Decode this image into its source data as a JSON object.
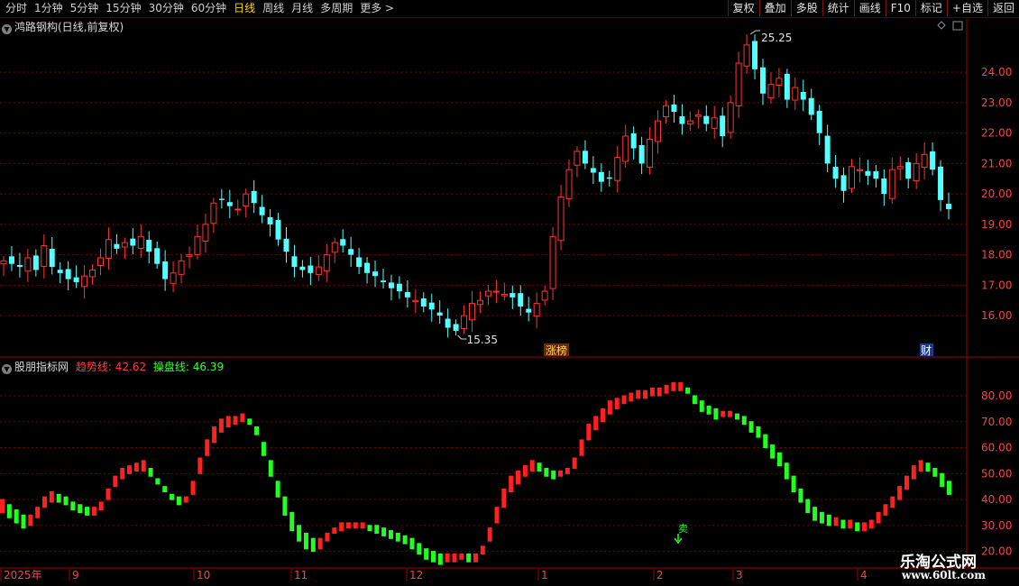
{
  "toolbar": {
    "periods": [
      "分时",
      "1分钟",
      "5分钟",
      "15分钟",
      "30分钟",
      "60分钟",
      "日线",
      "周线",
      "月线",
      "多周期",
      "更多 >"
    ],
    "active_period": "日线",
    "actions": [
      "复权",
      "叠加",
      "多股",
      "统计",
      "画线",
      "F10",
      "标记",
      "+自选",
      "返回"
    ]
  },
  "main_chart": {
    "title": "鸿路钢构(日线,前复权)",
    "y_ticks": [
      "16.00",
      "17.00",
      "18.00",
      "19.00",
      "20.00",
      "21.00",
      "22.00",
      "23.00",
      "24.00"
    ],
    "high_label": "25.25",
    "low_label": "15.35",
    "badge_limit_up": "涨榜",
    "badge_finance": "财"
  },
  "indicator": {
    "name": "股朋指标网",
    "trend_label": "趋势线:",
    "trend_value": "42.62",
    "operate_label": "操盘线:",
    "operate_value": "46.39",
    "y_ticks": [
      "20.00",
      "30.00",
      "40.00",
      "50.00",
      "60.00",
      "70.00",
      "80.00"
    ],
    "sell_marker": "卖"
  },
  "time_axis": [
    "2025年",
    "9",
    "10",
    "11",
    "12",
    "1",
    "2",
    "3",
    "4"
  ],
  "watermark": {
    "name": "乐淘公式网",
    "url": "www.60lt.com"
  },
  "colors": {
    "up": "#ff3333",
    "down": "#54ffff",
    "ind_up": "#ff2020",
    "ind_down": "#22ff22",
    "grid": "#7a0000",
    "active": "#ffd400"
  },
  "chart_data": [
    {
      "type": "candlestick",
      "title": "鸿路钢构(日线,前复权)",
      "ylim": [
        15.0,
        25.5
      ],
      "high": 25.25,
      "low": 15.35,
      "close_series": [
        17.8,
        17.7,
        17.6,
        17.9,
        17.5,
        18.3,
        17.6,
        17.4,
        17.2,
        17.1,
        17.3,
        17.5,
        17.9,
        18.5,
        18.2,
        18.4,
        18.3,
        18.6,
        18.1,
        17.7,
        17.2,
        17.4,
        17.8,
        18.0,
        18.6,
        19.0,
        19.7,
        19.8,
        19.6,
        19.5,
        20.0,
        19.7,
        19.3,
        19.0,
        18.5,
        18.1,
        17.6,
        17.5,
        17.4,
        17.6,
        18.0,
        18.4,
        18.3,
        18.0,
        17.6,
        17.4,
        17.3,
        17.1,
        16.9,
        16.8,
        16.6,
        16.5,
        16.3,
        16.2,
        16.0,
        15.6,
        15.5,
        16.0,
        16.4,
        16.5,
        16.8,
        16.8,
        16.7,
        16.6,
        16.3,
        16.1,
        16.4,
        16.8,
        18.6,
        19.9,
        20.8,
        21.4,
        21.0,
        20.7,
        20.4,
        20.5,
        21.2,
        21.9,
        21.5,
        21.0,
        21.8,
        22.4,
        22.9,
        22.7,
        22.3,
        22.4,
        22.6,
        22.3,
        22.5,
        21.9,
        23.0,
        24.3,
        24.9,
        24.1,
        23.3,
        23.6,
        23.8,
        23.1,
        23.5,
        23.1,
        22.6,
        22.0,
        21.0,
        20.5,
        20.1,
        20.9,
        20.8,
        20.6,
        20.5,
        20.0,
        20.8,
        20.9,
        20.5,
        21.0,
        21.3,
        20.8,
        19.8,
        19.5
      ]
    },
    {
      "type": "area",
      "title": "股朋指标网",
      "ylim": [
        15,
        88
      ],
      "series": [
        {
          "name": "趋势线",
          "values": [
            39,
            37,
            35,
            33,
            33,
            36,
            40,
            42,
            41,
            40,
            38,
            37,
            36,
            36,
            38,
            43,
            48,
            51,
            52,
            53,
            54,
            51,
            47,
            44,
            41,
            39,
            40,
            46,
            55,
            62,
            67,
            70,
            71,
            71,
            72,
            70,
            66,
            58,
            50,
            42,
            35,
            29,
            25,
            22,
            21,
            22,
            25,
            28,
            30,
            30,
            30,
            30,
            29,
            28,
            27,
            26,
            25,
            24,
            22,
            20,
            18,
            17,
            16,
            17,
            17,
            18,
            17,
            17,
            21,
            28,
            36,
            43,
            48,
            50,
            52,
            54,
            53,
            50,
            49,
            50,
            51,
            55,
            62,
            68,
            71,
            74,
            77,
            78,
            79,
            80,
            81,
            81,
            82,
            82,
            83,
            84,
            84,
            82,
            78,
            75,
            74,
            72,
            73,
            73,
            72,
            70,
            67,
            65,
            61,
            57,
            54,
            49,
            44,
            40,
            36,
            33,
            32,
            31,
            31,
            30,
            30,
            29,
            29,
            31,
            34,
            37,
            40,
            44,
            48,
            52,
            54,
            53,
            50,
            46,
            43
          ]
        },
        {
          "name": "操盘线",
          "values": [
            36,
            34,
            32,
            30,
            31,
            34,
            38,
            40,
            40,
            39,
            37,
            36,
            35,
            35,
            37,
            41,
            46,
            49,
            51,
            52,
            52,
            50,
            47,
            44,
            41,
            40,
            40,
            43,
            51,
            58,
            63,
            67,
            69,
            70,
            71,
            70,
            67,
            61,
            54,
            46,
            40,
            34,
            29,
            26,
            24,
            24,
            26,
            28,
            29,
            30,
            30,
            30,
            29,
            29,
            28,
            27,
            26,
            25,
            24,
            22,
            20,
            19,
            18,
            18,
            18,
            18,
            18,
            18,
            20,
            25,
            32,
            38,
            44,
            47,
            50,
            52,
            52,
            51,
            50,
            50,
            51,
            53,
            58,
            64,
            68,
            71,
            74,
            76,
            78,
            79,
            80,
            80,
            81,
            81,
            82,
            83,
            83,
            82,
            79,
            77,
            75,
            74,
            73,
            73,
            72,
            71,
            69,
            67,
            64,
            60,
            57,
            53,
            48,
            43,
            39,
            36,
            34,
            33,
            32,
            31,
            31,
            30,
            30,
            30,
            32,
            35,
            38,
            41,
            45,
            49,
            52,
            52,
            51,
            49,
            46
          ]
        }
      ]
    }
  ]
}
